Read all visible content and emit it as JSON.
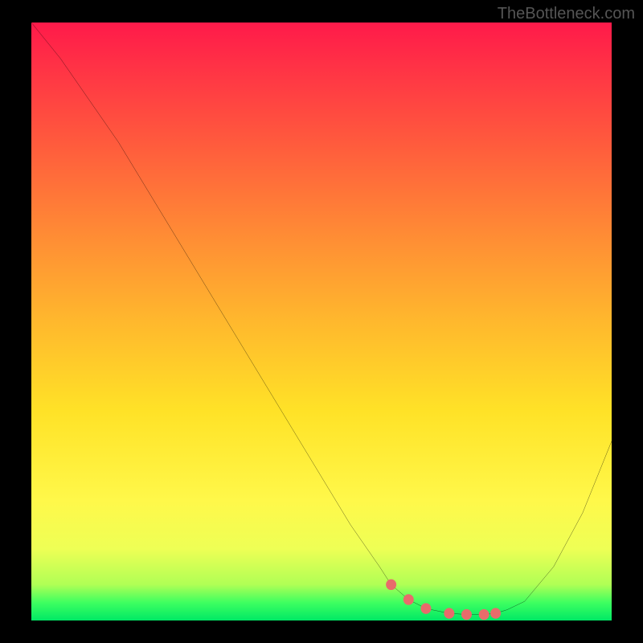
{
  "watermark": "TheBottleneck.com",
  "chart_data": {
    "type": "line",
    "title": "",
    "xlabel": "",
    "ylabel": "",
    "xlim": [
      0,
      100
    ],
    "ylim": [
      0,
      100
    ],
    "x": [
      0,
      5,
      10,
      15,
      20,
      25,
      30,
      35,
      40,
      45,
      50,
      55,
      60,
      62,
      65,
      68,
      72,
      75,
      78,
      80,
      82,
      85,
      90,
      95,
      100
    ],
    "y": [
      100,
      94,
      87,
      80,
      72,
      64,
      56,
      48,
      40,
      32,
      24,
      16,
      9,
      6,
      3.5,
      2,
      1.2,
      1,
      1,
      1.2,
      1.8,
      3.2,
      9,
      18,
      30
    ],
    "trough_markers": {
      "x": [
        62,
        65,
        68,
        72,
        75,
        78,
        80
      ],
      "y": [
        6,
        3.5,
        2,
        1.2,
        1,
        1,
        1.2
      ]
    },
    "colors": {
      "curve": "#000000",
      "markers": "#e86b6b",
      "background_top": "#ff1a4a",
      "background_bottom": "#00e865"
    }
  }
}
